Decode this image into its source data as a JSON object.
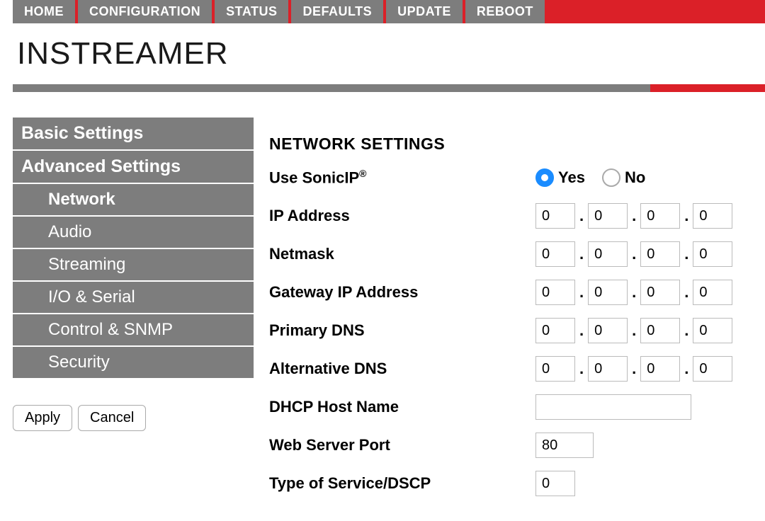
{
  "topnav": {
    "items": [
      "HOME",
      "CONFIGURATION",
      "STATUS",
      "DEFAULTS",
      "UPDATE",
      "REBOOT"
    ]
  },
  "page_title": "INSTREAMER",
  "sidebar": {
    "items": [
      {
        "label": "Basic Settings",
        "type": "header",
        "active": false
      },
      {
        "label": "Advanced Settings",
        "type": "header",
        "active": true
      },
      {
        "label": "Network",
        "type": "sub",
        "active": true
      },
      {
        "label": "Audio",
        "type": "sub",
        "active": false
      },
      {
        "label": "Streaming",
        "type": "sub",
        "active": false
      },
      {
        "label": "I/O & Serial",
        "type": "sub",
        "active": false
      },
      {
        "label": "Control & SNMP",
        "type": "sub",
        "active": false
      },
      {
        "label": "Security",
        "type": "sub",
        "active": false
      }
    ],
    "apply_label": "Apply",
    "cancel_label": "Cancel"
  },
  "main": {
    "section_title": "NETWORK SETTINGS",
    "sonicip": {
      "label": "Use SonicIP",
      "reg": "®",
      "yes": "Yes",
      "no": "No",
      "value": "yes"
    },
    "fields": {
      "ip_address": {
        "label": "IP Address",
        "octets": [
          "0",
          "0",
          "0",
          "0"
        ]
      },
      "netmask": {
        "label": "Netmask",
        "octets": [
          "0",
          "0",
          "0",
          "0"
        ]
      },
      "gateway": {
        "label": "Gateway IP Address",
        "octets": [
          "0",
          "0",
          "0",
          "0"
        ]
      },
      "primary_dns": {
        "label": "Primary DNS",
        "octets": [
          "0",
          "0",
          "0",
          "0"
        ]
      },
      "alt_dns": {
        "label": "Alternative DNS",
        "octets": [
          "0",
          "0",
          "0",
          "0"
        ]
      },
      "dhcp_host": {
        "label": "DHCP Host Name",
        "value": ""
      },
      "web_port": {
        "label": "Web Server Port",
        "value": "80"
      },
      "tos_dscp": {
        "label": "Type of Service/DSCP",
        "value": "0"
      }
    }
  }
}
